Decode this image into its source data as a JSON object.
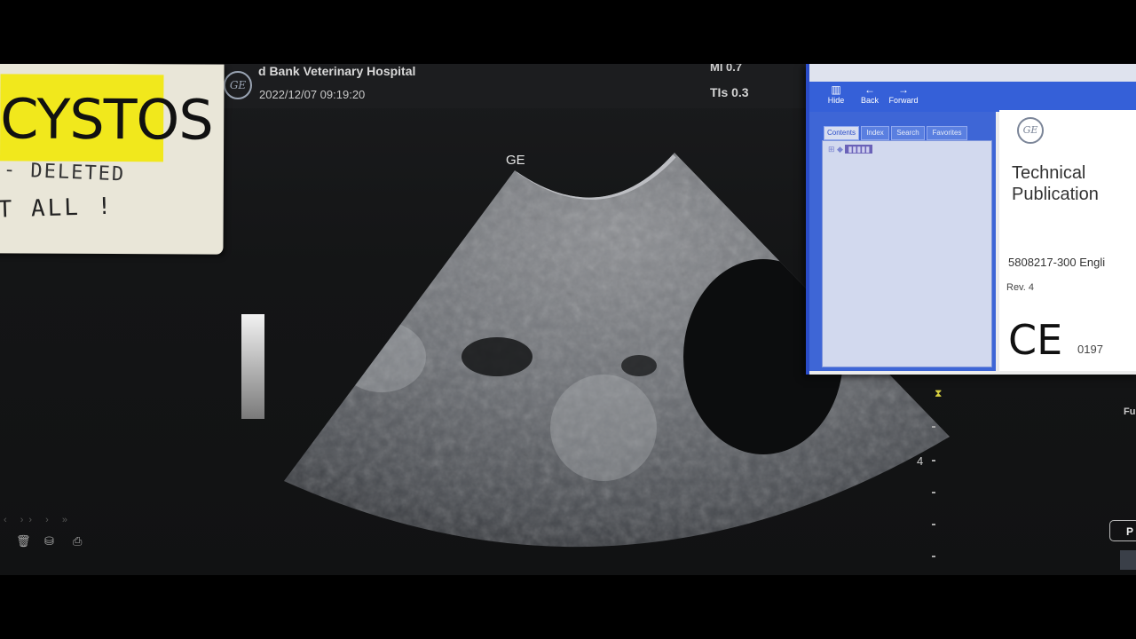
{
  "header": {
    "hospital_name": "d Bank Veterinary Hospital",
    "datetime": "2022/12/07 09:19:20",
    "mi": "MI 0.7",
    "tis": "TIs 0.3"
  },
  "note": {
    "title": "CYSTOS",
    "line2": "- DELETED",
    "line3": "T ALL !"
  },
  "image_area": {
    "ge_mark": "GE",
    "depth_label": "4"
  },
  "help_window": {
    "toolbar": {
      "hide": "Hide",
      "back": "Back",
      "forward": "Forward"
    },
    "tabs": [
      "Contents",
      "Index",
      "Search",
      "Favorites"
    ],
    "doc": {
      "title_line1": "Technical",
      "title_line2": "Publication",
      "number": "5808217-300 Engli",
      "rev": "Rev. 4",
      "ce": "CE",
      "ce_number": "0197"
    }
  },
  "right_edge": {
    "fu_label": "Fu",
    "p_button": "P"
  }
}
